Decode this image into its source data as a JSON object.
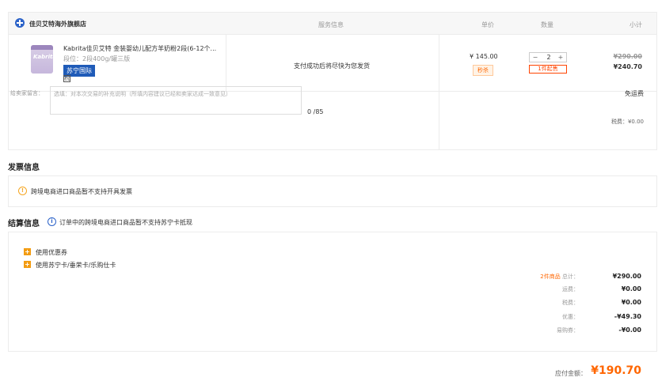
{
  "store": {
    "name": "佳贝艾特海外旗舰店"
  },
  "columns": {
    "service": "服务信息",
    "unit_price": "单价",
    "quantity": "数量",
    "subtotal": "小计"
  },
  "product": {
    "image_text": "Kabrita",
    "title": "Kabrita佳贝艾特 金装婴幼儿配方羊奶粉2段(6-12个...",
    "spec": "段位：2段400g/罐三版",
    "badge": "苏宁国际",
    "service": "支付成功后将尽快为您发货",
    "unit_price": "¥ 145.00",
    "promo_tag": "秒杀",
    "qty": "2",
    "qty_minus": "−",
    "qty_plus": "+",
    "min_buy": "1件起售",
    "orig_total": "¥290.00",
    "cur_total": "¥240.70"
  },
  "note": {
    "label": "给卖家留言：",
    "placeholder": "选填：对本次交易的补充说明（所填内容建议已经和卖家达成一致意见）",
    "count": "0 /85"
  },
  "shipping": {
    "free": "免运费",
    "tax": "税费：¥0.00"
  },
  "invoice": {
    "title": "发票信息",
    "notice": "跨境电商进口商品暂不支持开具发票"
  },
  "settlement": {
    "title": "结算信息",
    "notice": "订单中的跨境电商进口商品暂不支持苏宁卡抵现",
    "options": [
      "使用优惠券",
      "使用苏宁卡/垂荣卡/乐购仕卡"
    ]
  },
  "summary": {
    "items_count": "2件商品",
    "total_label": "总计：",
    "total": "¥290.00",
    "freight_label": "运费：",
    "freight": "¥0.00",
    "tax_label": "税费：",
    "tax": "¥0.00",
    "discount_label": "优惠：",
    "discount": "-¥49.30",
    "points_label": "易购券：",
    "points": "-¥0.00",
    "pay_label": "应付金额：",
    "pay": "¥190.70"
  },
  "colors": {
    "accent": "#ff6600",
    "brand_blue": "#1f5bb8"
  }
}
